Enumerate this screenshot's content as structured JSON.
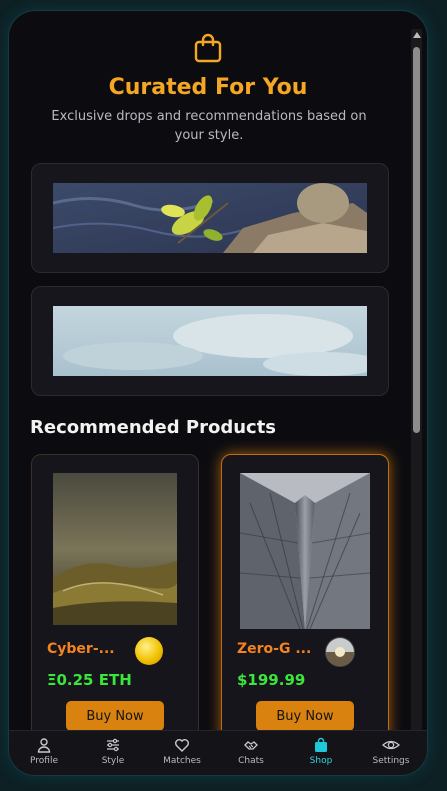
{
  "header": {
    "icon": "shopping-bag-icon",
    "title": "Curated For You",
    "subtitle": "Exclusive drops and recommendations based on your style."
  },
  "banners": [
    {
      "image": "leaves-on-rocks-by-water"
    },
    {
      "image": "pale-sky-clouds"
    }
  ],
  "section_title": "Recommended Products",
  "products": [
    {
      "name": "Cyber-...",
      "price": "Ξ0.25 ETH",
      "button": "Buy Now",
      "image": "misty-hillside",
      "badge": "gold-coin"
    },
    {
      "name": "Zero-G ...",
      "price": "$199.99",
      "button": "Buy Now",
      "image": "glass-skyscraper",
      "badge": "landscape-thumb"
    }
  ],
  "nav": [
    {
      "label": "Profile",
      "icon": "person-icon",
      "active": false
    },
    {
      "label": "Style",
      "icon": "sliders-icon",
      "active": false
    },
    {
      "label": "Matches",
      "icon": "heart-icon",
      "active": false
    },
    {
      "label": "Chats",
      "icon": "handshake-icon",
      "active": false
    },
    {
      "label": "Shop",
      "icon": "shopping-bag-icon",
      "active": true
    },
    {
      "label": "Settings",
      "icon": "eye-gear-icon",
      "active": false
    }
  ],
  "colors": {
    "accent": "#f5a623",
    "price": "#39e639",
    "button": "#d9820f",
    "active_nav": "#2fd6e6"
  }
}
